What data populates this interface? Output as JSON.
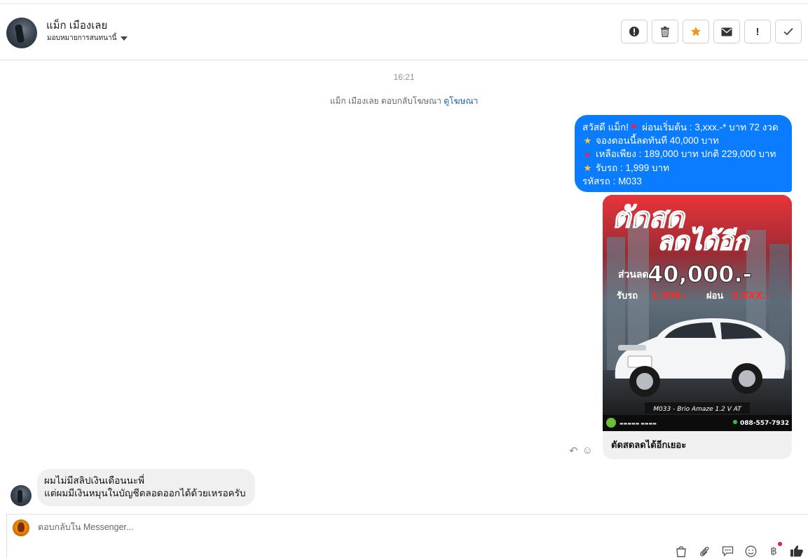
{
  "header": {
    "contact_name": "แม็ก เมืองเลย",
    "assign_label": "มอบหมายการสนทนานี้",
    "actions": [
      {
        "name": "spam-icon",
        "label": "!"
      },
      {
        "name": "trash-icon",
        "label": ""
      },
      {
        "name": "star-icon",
        "label": ""
      },
      {
        "name": "mail-icon",
        "label": ""
      },
      {
        "name": "exclamation-icon",
        "label": "!"
      },
      {
        "name": "checkmark-icon",
        "label": "✓"
      }
    ]
  },
  "conversation": {
    "timestamp": "16:21",
    "ad_reply_text": "แม็ก เมืองเลย ตอบกลับโฆษณา",
    "ad_reply_link": "ดูโฆษณา",
    "outgoing": {
      "lines": [
        "สวัสดี แม็ก! ",
        " ผ่อนเริ่มต้น : 3,xxx.-* บาท 72 งวด",
        "จองตอนนี้ลดทันที 40,000 บาท",
        "เหลือเพียง : 189,000 บาท ปกติ 229,000 บาท",
        "รับรถ : 1,999 บาท",
        "รหัสรถ : M033"
      ]
    },
    "card": {
      "headline_1": "ตัดสด",
      "headline_2": "ลดได้อีก",
      "discount_prefix": "ส่วนลด",
      "discount_value": "40,000.-",
      "receive_label": "รับรถ",
      "receive_value": "1,999.-",
      "installment_label": "ผ่อน",
      "installment_value": "3,XXX.-",
      "model_text": "M033 - Brio Amaze 1.2 V AT",
      "phone": "088-557-7932",
      "title": "ตัดสดลดได้อีกเยอะ"
    },
    "incoming": {
      "line1": "ผมไม่มีสลิปเงินเดือนนะพี่",
      "line2": "แต่ผมมีเงินหมุนในบัญชีตลอดออกได้ด้วยเหรอครับ"
    }
  },
  "composer": {
    "placeholder": "ตอบกลับใน Messenger...",
    "tools": [
      "bag-icon",
      "paperclip-icon",
      "quick-reply-icon",
      "emoji-icon",
      "baht-icon",
      "like-icon"
    ]
  }
}
